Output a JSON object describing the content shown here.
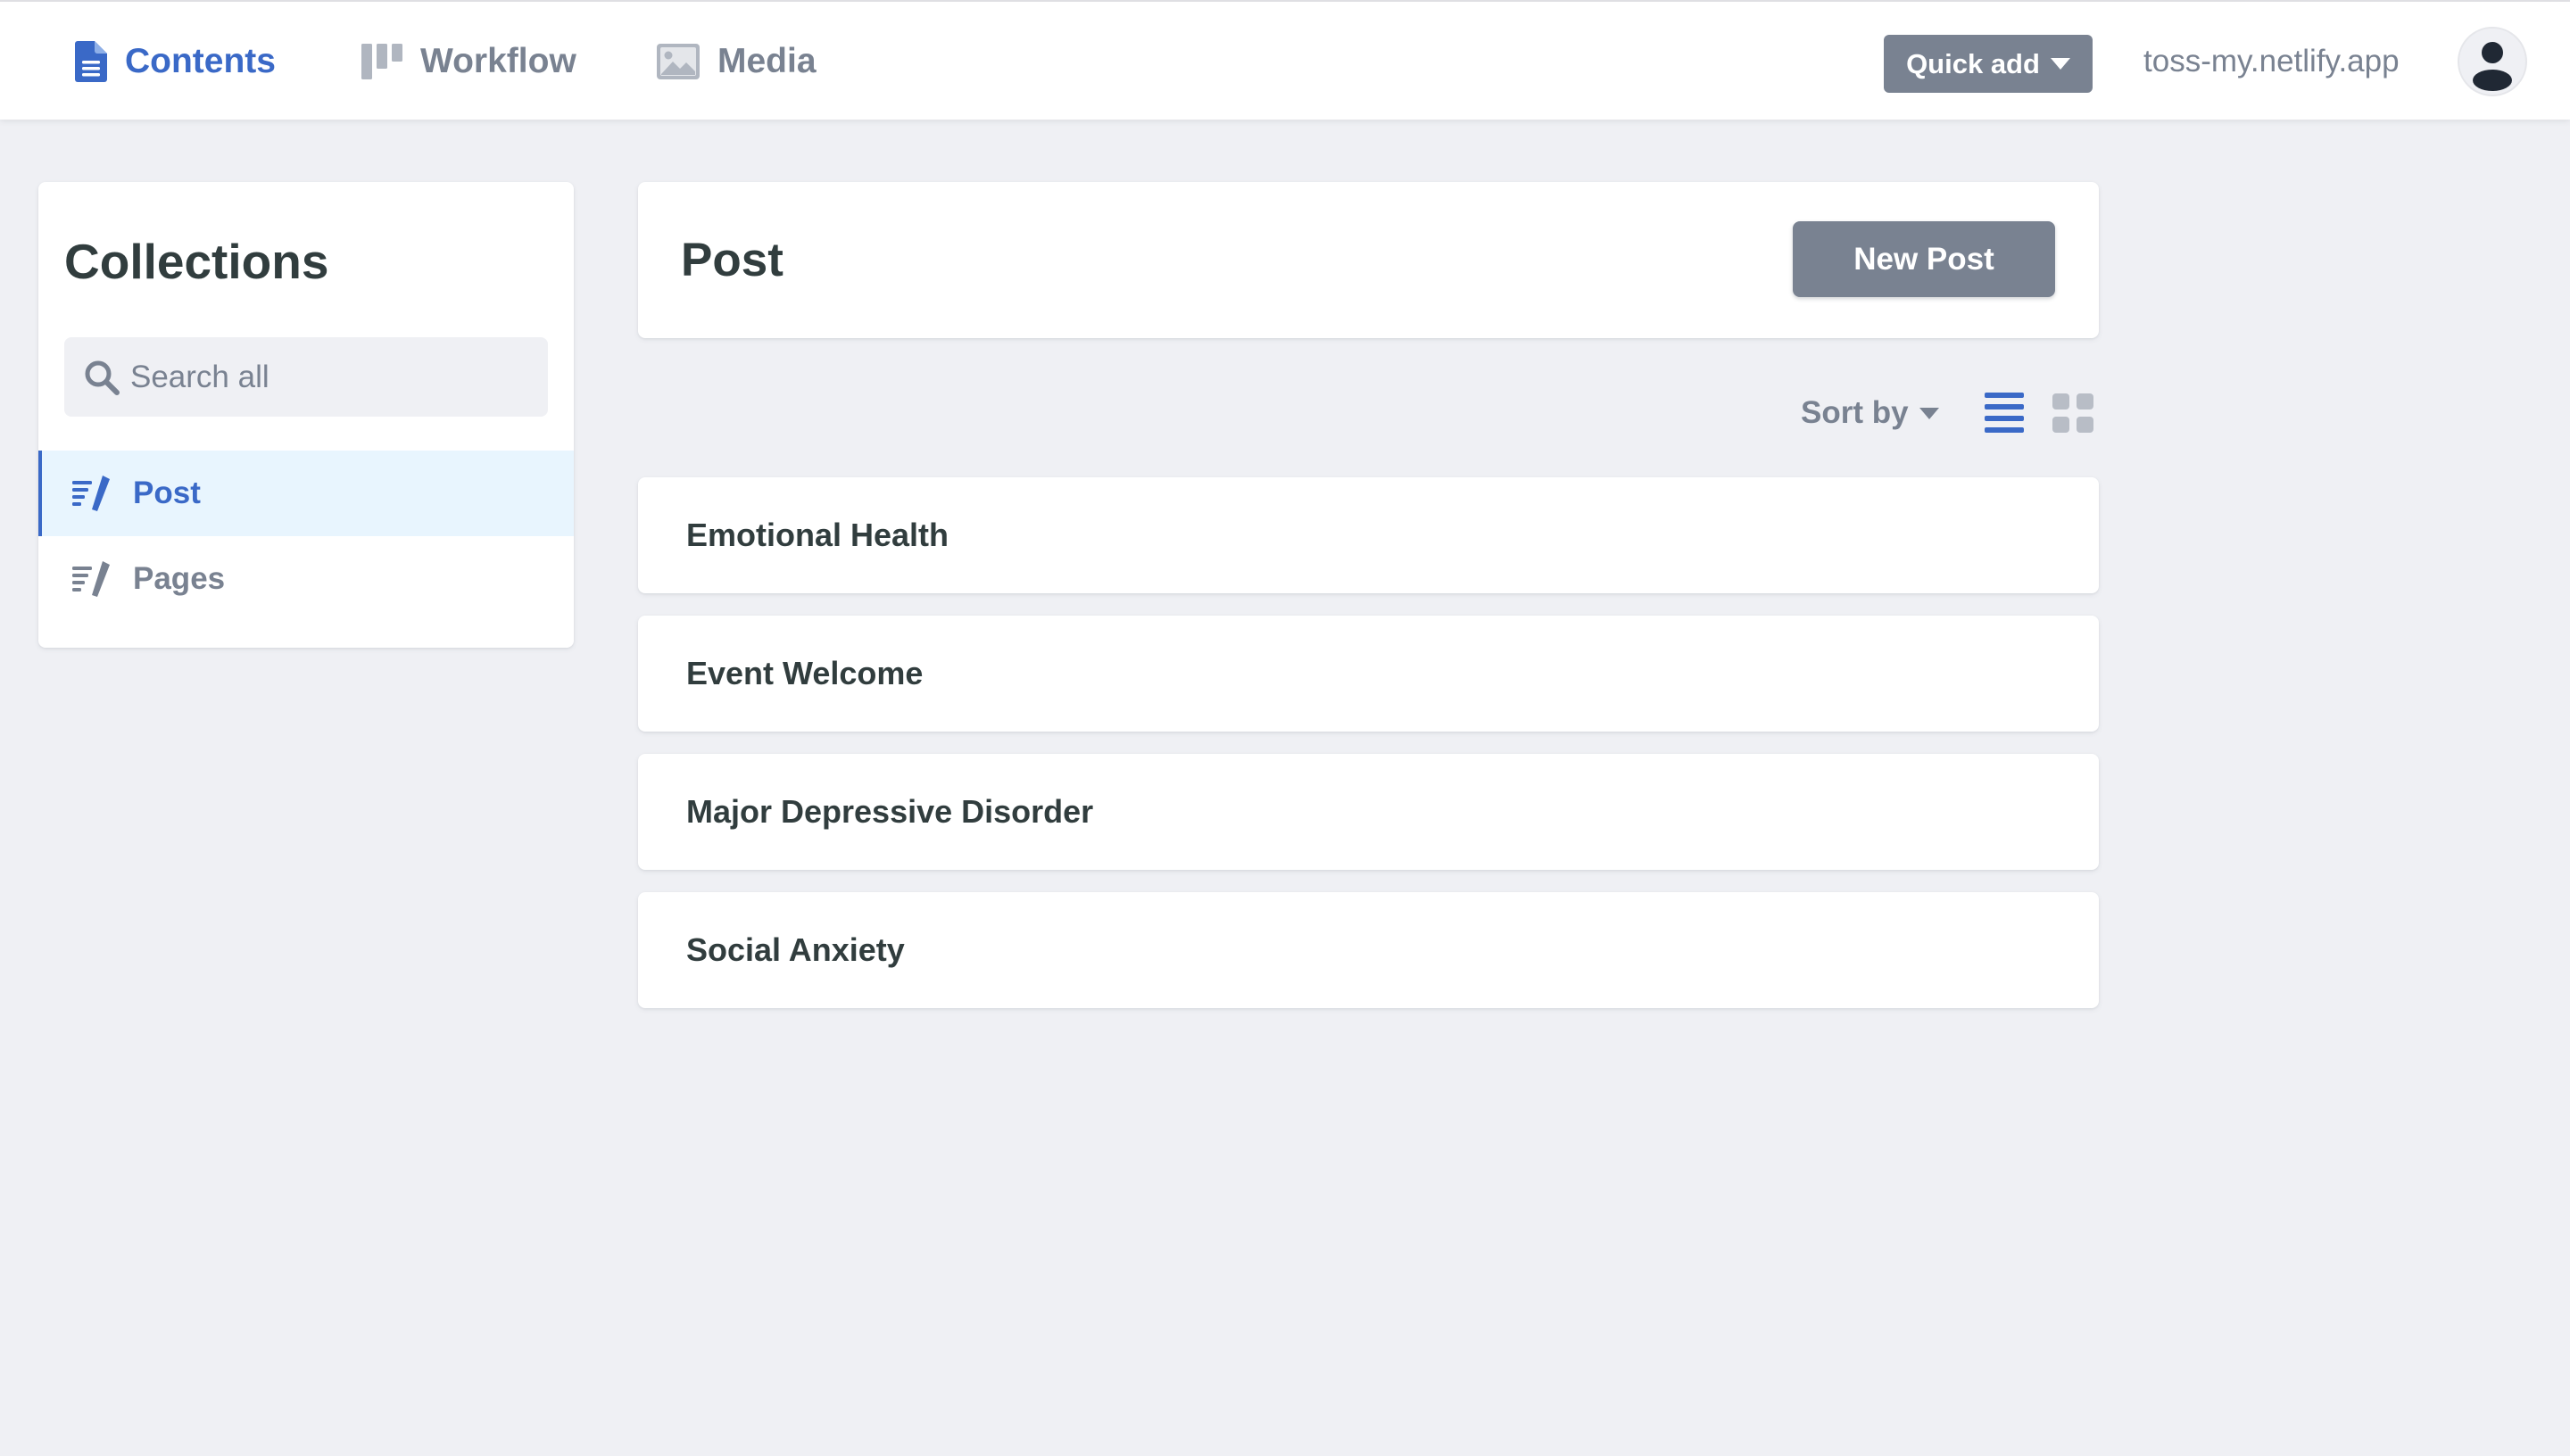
{
  "topbar": {
    "nav": [
      {
        "label": "Contents",
        "icon": "document-icon",
        "active": true
      },
      {
        "label": "Workflow",
        "icon": "workflow-icon",
        "active": false
      },
      {
        "label": "Media",
        "icon": "image-icon",
        "active": false
      }
    ],
    "quick_add_label": "Quick add",
    "site_url": "toss-my.netlify.app"
  },
  "sidebar": {
    "title": "Collections",
    "search_placeholder": "Search all",
    "collections": [
      {
        "label": "Post",
        "icon": "write-icon",
        "active": true
      },
      {
        "label": "Pages",
        "icon": "write-icon",
        "active": false
      }
    ]
  },
  "main": {
    "title": "Post",
    "new_button_label": "New Post",
    "sort_label": "Sort by",
    "entries": [
      "Emotional Health",
      "Event Welcome",
      "Major Depressive Disorder",
      "Social Anxiety"
    ]
  },
  "colors": {
    "accent": "#3a69c7",
    "muted": "#798291",
    "background": "#eff0f4",
    "text": "#313d3e"
  }
}
